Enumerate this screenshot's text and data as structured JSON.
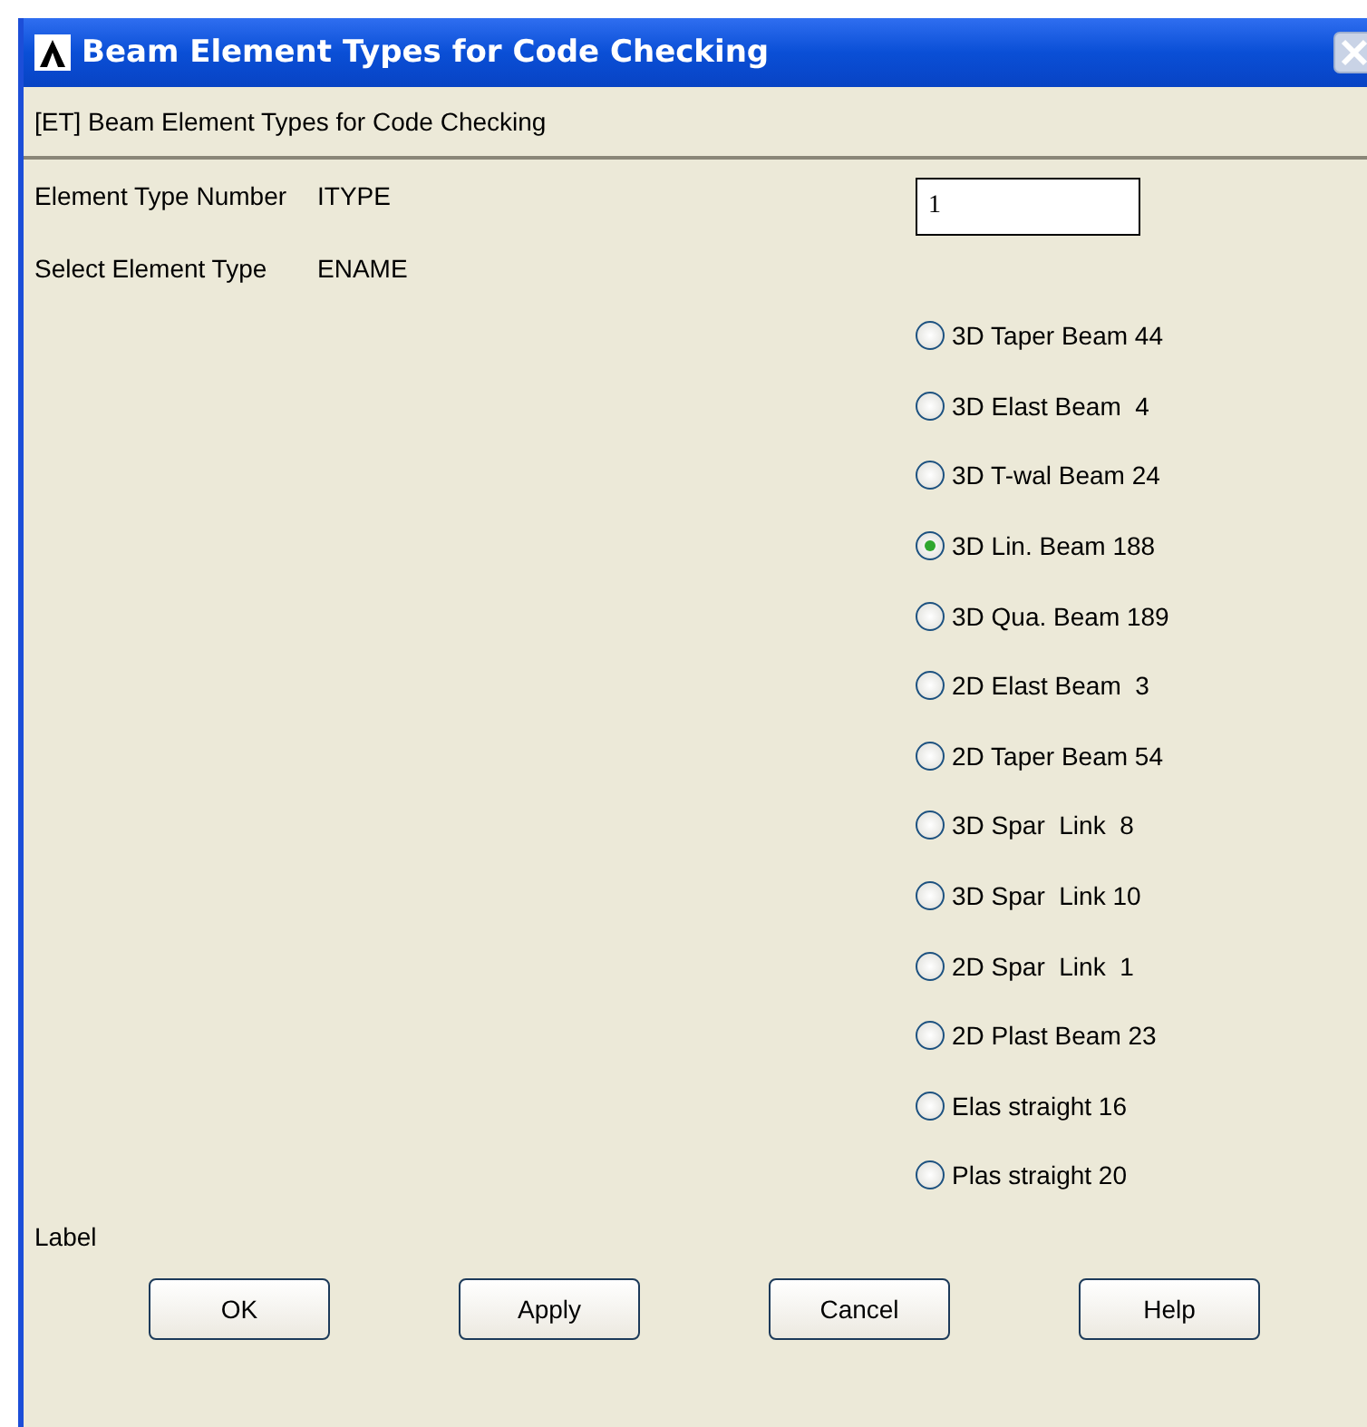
{
  "window": {
    "title": "Beam Element Types for Code Checking"
  },
  "header": "[ET] Beam Element Types for Code Checking",
  "fields": [
    {
      "label": "Element Type Number",
      "param": "ITYPE",
      "kind": "input",
      "value": "1"
    },
    {
      "label": "Select Element Type",
      "param": "ENAME",
      "kind": "radio"
    }
  ],
  "options": [
    {
      "label": "3D Taper Beam 44",
      "selected": false
    },
    {
      "label": "3D Elast Beam  4",
      "selected": false
    },
    {
      "label": "3D T-wal Beam 24",
      "selected": false
    },
    {
      "label": "3D Lin. Beam 188",
      "selected": true
    },
    {
      "label": "3D Qua. Beam 189",
      "selected": false
    },
    {
      "label": "2D Elast Beam  3",
      "selected": false
    },
    {
      "label": "2D Taper Beam 54",
      "selected": false
    },
    {
      "label": "3D Spar  Link  8",
      "selected": false
    },
    {
      "label": "3D Spar  Link 10",
      "selected": false
    },
    {
      "label": "2D Spar  Link  1",
      "selected": false
    },
    {
      "label": "2D Plast Beam 23",
      "selected": false
    },
    {
      "label": "Elas straight 16",
      "selected": false
    },
    {
      "label": "Plas straight 20",
      "selected": false
    }
  ],
  "label": "Label",
  "buttons": [
    "OK",
    "Apply",
    "Cancel",
    "Help"
  ]
}
